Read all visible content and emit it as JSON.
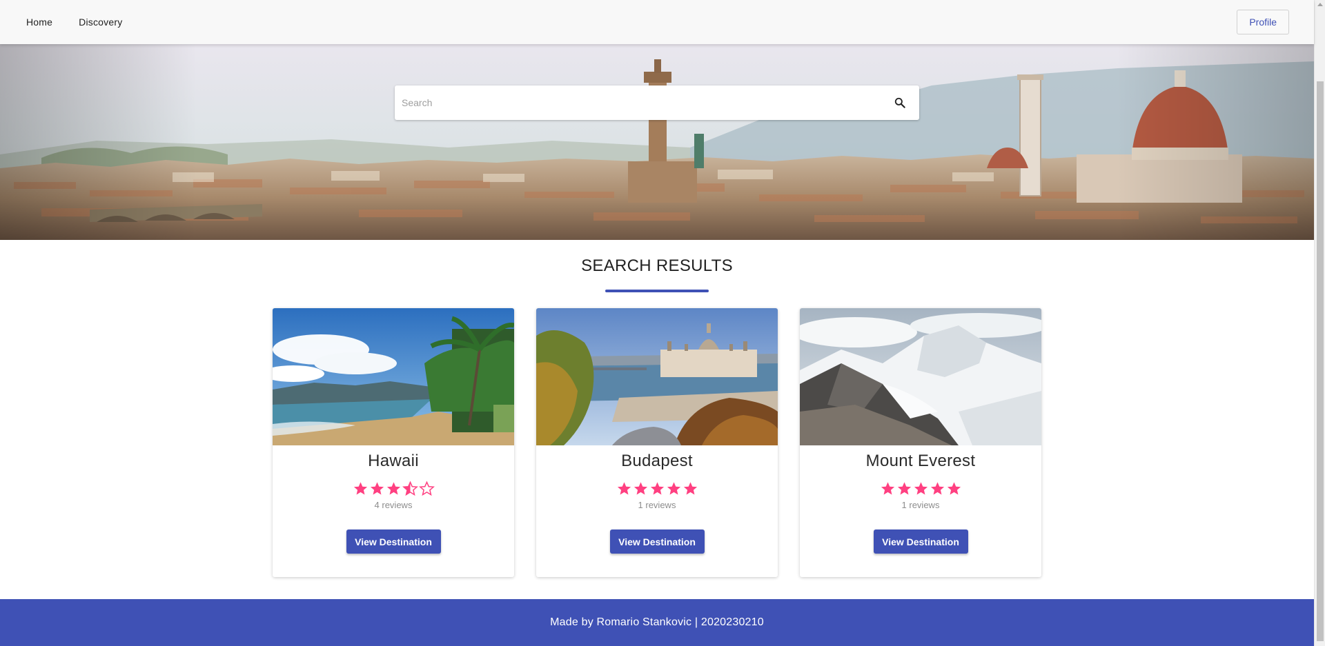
{
  "nav": {
    "home_label": "Home",
    "discovery_label": "Discovery",
    "profile_label": "Profile"
  },
  "search": {
    "placeholder": "Search"
  },
  "results": {
    "title": "SEARCH RESULTS",
    "cards": [
      {
        "title": "Hawaii",
        "rating": 3.5,
        "reviews": "4 reviews",
        "button": "View Destination"
      },
      {
        "title": "Budapest",
        "rating": 5,
        "reviews": "1 reviews",
        "button": "View Destination"
      },
      {
        "title": "Mount Everest",
        "rating": 5,
        "reviews": "1 reviews",
        "button": "View Destination"
      }
    ]
  },
  "footer": {
    "text": "Made by Romario Stankovic | 2020230210"
  },
  "colors": {
    "accent": "#3f51b5",
    "star": "#ff4081"
  }
}
